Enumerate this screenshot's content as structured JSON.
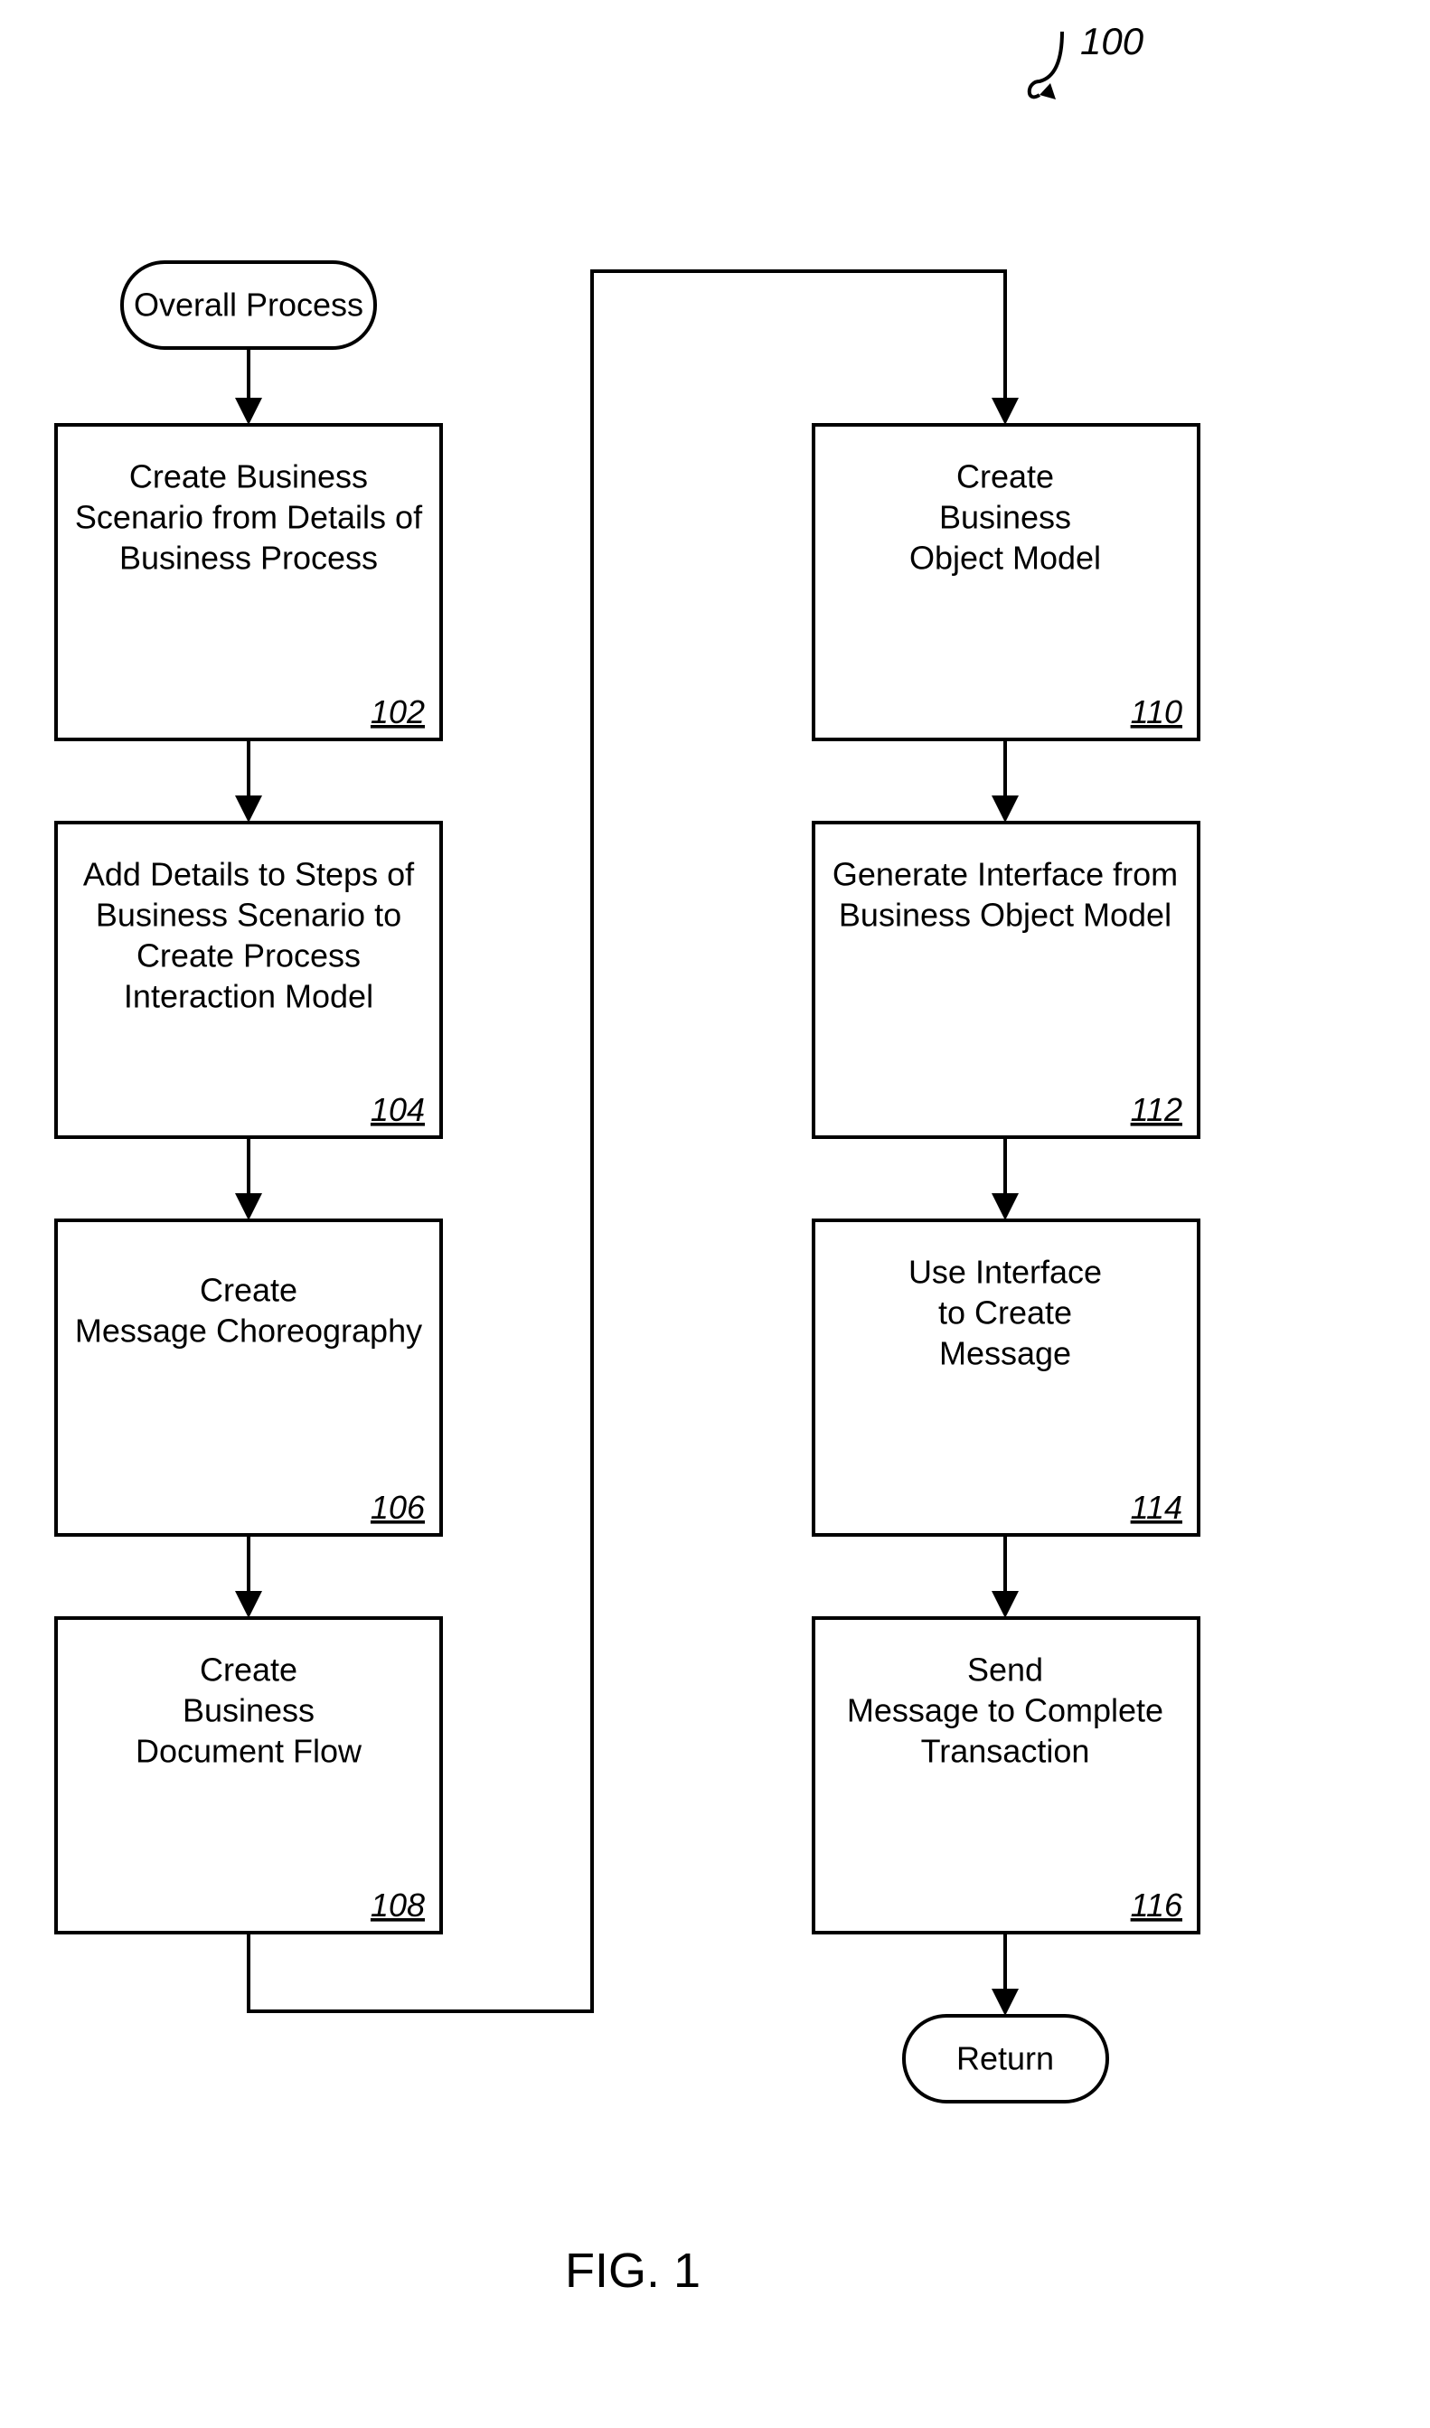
{
  "figure_ref": "100",
  "figure_label": "FIG. 1",
  "start_label": "Overall Process",
  "end_label": "Return",
  "steps": [
    {
      "id": "102",
      "lines": [
        "Create Business",
        "Scenario from Details of",
        "Business Process"
      ]
    },
    {
      "id": "104",
      "lines": [
        "Add Details to Steps of",
        "Business Scenario to",
        "Create Process",
        "Interaction Model"
      ]
    },
    {
      "id": "106",
      "lines": [
        "Create",
        "Message Choreography"
      ]
    },
    {
      "id": "108",
      "lines": [
        "Create",
        "Business",
        "Document Flow"
      ]
    },
    {
      "id": "110",
      "lines": [
        "Create",
        "Business",
        "Object Model"
      ]
    },
    {
      "id": "112",
      "lines": [
        "Generate Interface from",
        "Business Object Model"
      ]
    },
    {
      "id": "114",
      "lines": [
        "Use Interface",
        "to Create",
        "Message"
      ]
    },
    {
      "id": "116",
      "lines": [
        "Send",
        "Message to Complete",
        "Transaction"
      ]
    }
  ]
}
